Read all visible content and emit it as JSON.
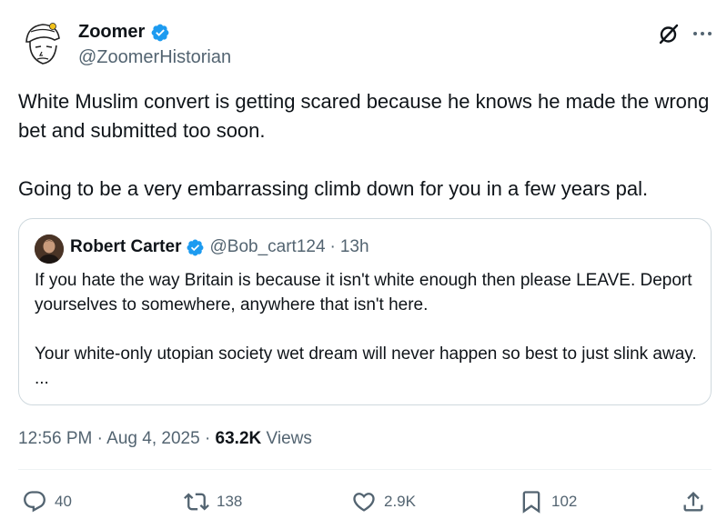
{
  "author": {
    "name": "Zoomer",
    "handle": "@ZoomerHistorian"
  },
  "tweet": {
    "paragraphs": [
      "White Muslim convert is getting scared because he knows he made the wrong bet and submitted too soon.",
      "Going to be a very embarrassing climb down for you in a few years pal."
    ]
  },
  "quoted": {
    "name": "Robert Carter",
    "handle": "@Bob_cart124",
    "separator": "·",
    "time": "13h",
    "paragraphs": [
      "If you hate the way Britain is because it isn't white enough then please LEAVE. Deport yourselves to somewhere, anywhere that isn't here.",
      "Your white-only utopian society wet dream will never happen so best to just slink away. ..."
    ]
  },
  "meta": {
    "time": "12:56 PM",
    "sep1": "·",
    "date": "Aug 4, 2025",
    "sep2": "·",
    "views_count": "63.2K",
    "views_label": "Views"
  },
  "actions": {
    "replies": "40",
    "reposts": "138",
    "likes": "2.9K",
    "bookmarks": "102"
  },
  "colors": {
    "text": "#0f1419",
    "secondary": "#536471",
    "verified": "#1d9bf0",
    "border": "#cfd9de"
  },
  "icons": [
    "verified-badge-icon",
    "grok-icon",
    "more-icon",
    "reply-icon",
    "repost-icon",
    "like-icon",
    "bookmark-icon",
    "share-icon"
  ]
}
